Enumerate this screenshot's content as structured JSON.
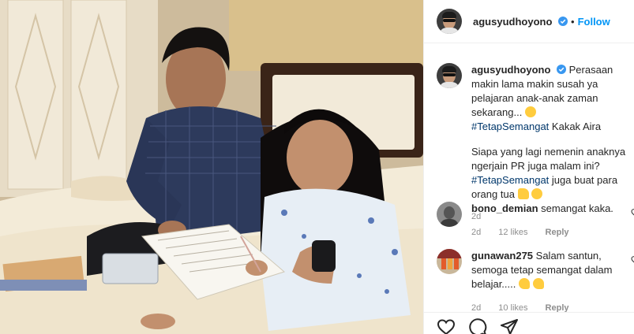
{
  "header": {
    "username": "agusyudhoyono",
    "separator": "•",
    "follow_label": "Follow"
  },
  "caption": {
    "username": "agusyudhoyono",
    "text1": "Perasaan makin lama makin susah ya pelajaran anak-anak zaman sekarang...",
    "hashtag1": "#TetapSemangat",
    "text2": "Kakak Aira",
    "text3": "Siapa yang lagi nemenin anaknya ngerjain PR juga malam ini?",
    "hashtag2": "#TetapSemangat",
    "text4": "juga buat para orang tua",
    "time": "2d"
  },
  "comments": [
    {
      "username": "bono_demian",
      "text": "semangat kaka.",
      "time": "2d",
      "likes": "12 likes",
      "reply_label": "Reply"
    },
    {
      "username": "gunawan275",
      "text": "Salam santun, semoga tetap semangat dalam belajar.....",
      "time": "2d",
      "likes": "10 likes",
      "reply_label": "Reply"
    }
  ],
  "icons": {
    "verified": "verified-badge-icon",
    "like": "heart-icon",
    "comment": "comment-icon",
    "share": "share-icon",
    "comment_like": "small-heart-icon"
  },
  "colors": {
    "follow": "#0095f6",
    "hashtag": "#00376b",
    "meta": "#8e8e8e"
  }
}
